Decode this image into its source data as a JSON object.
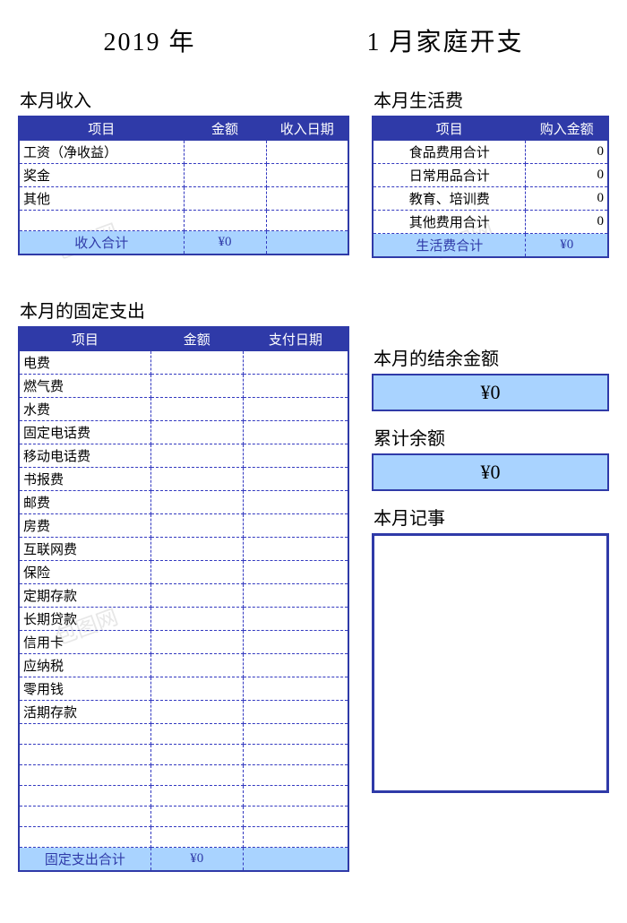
{
  "title": {
    "left": "2019 年",
    "right": "1 月家庭开支"
  },
  "income": {
    "heading": "本月收入",
    "cols": [
      "项目",
      "金额",
      "收入日期"
    ],
    "rows": [
      "工资（净收益）",
      "奖金",
      "其他",
      ""
    ],
    "total_label": "收入合计",
    "total_value": "¥0"
  },
  "living": {
    "heading": "本月生活费",
    "cols": [
      "项目",
      "购入金额"
    ],
    "rows": [
      {
        "label": "食品费用合计",
        "val": "0"
      },
      {
        "label": "日常用品合计",
        "val": "0"
      },
      {
        "label": "教育、培训费",
        "val": "0"
      },
      {
        "label": "其他费用合计",
        "val": "0"
      }
    ],
    "total_label": "生活费合计",
    "total_value": "¥0"
  },
  "fixed": {
    "heading": "本月的固定支出",
    "cols": [
      "项目",
      "金额",
      "支付日期"
    ],
    "rows": [
      "电费",
      "燃气费",
      "水费",
      "固定电话费",
      "移动电话费",
      "书报费",
      "邮费",
      "房费",
      "互联网费",
      "保险",
      "定期存款",
      "长期贷款",
      "信用卡",
      "应纳税",
      "零用钱",
      "活期存款",
      "",
      "",
      "",
      "",
      "",
      ""
    ],
    "total_label": "固定支出合计",
    "total_value": "¥0"
  },
  "balance_month": {
    "heading": "本月的结余金额",
    "value": "¥0"
  },
  "balance_cum": {
    "heading": "累计余额",
    "value": "¥0"
  },
  "notes": {
    "heading": "本月记事"
  },
  "watermark": "包图网"
}
